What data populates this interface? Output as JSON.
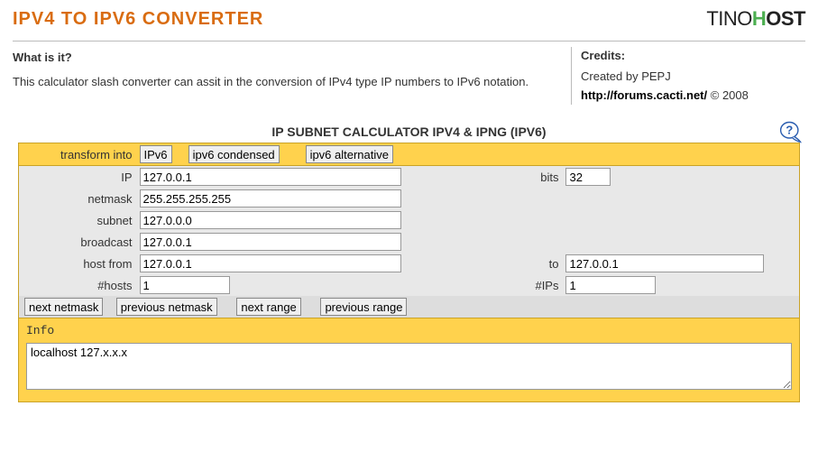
{
  "header": {
    "title": "IPV4 TO IPV6 CONVERTER",
    "logo": {
      "part1": "TINO",
      "part2": "H",
      "part3": "OST"
    }
  },
  "about": {
    "heading": "What is it?",
    "text": "This calculator slash converter can assit in the conversion of IPv4 type IP numbers to IPv6 notation."
  },
  "credits": {
    "heading": "Credits:",
    "created": "Created by PEPJ",
    "link": "http://forums.cacti.net/",
    "year": "© 2008"
  },
  "calc": {
    "title": "IP SUBNET CALCULATOR IPV4 & IPNG (IPV6)",
    "transform_label": "transform into",
    "buttons": {
      "ipv6": "IPv6",
      "ipv6c": "ipv6 condensed",
      "ipv6a": "ipv6 alternative",
      "next_netmask": "next netmask",
      "prev_netmask": "previous netmask",
      "next_range": "next range",
      "prev_range": "previous range"
    },
    "labels": {
      "ip": "IP",
      "bits": "bits",
      "netmask": "netmask",
      "subnet": "subnet",
      "broadcast": "broadcast",
      "hostfrom": "host from",
      "to": "to",
      "hosts": "#hosts",
      "ips": "#IPs"
    },
    "values": {
      "ip": "127.0.0.1",
      "bits": "32",
      "netmask": "255.255.255.255",
      "subnet": "127.0.0.0",
      "broadcast": "127.0.0.1",
      "hostfrom": "127.0.0.1",
      "to": "127.0.0.1",
      "hosts": "1",
      "ips": "1"
    },
    "info_label": "Info",
    "info_text": "localhost 127.x.x.x"
  }
}
